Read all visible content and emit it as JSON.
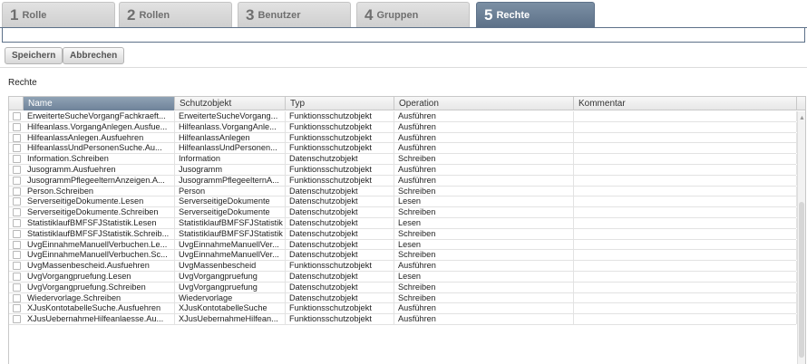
{
  "tabs": [
    {
      "num": "1",
      "label": "Rolle",
      "active": false
    },
    {
      "num": "2",
      "label": "Rollen",
      "active": false
    },
    {
      "num": "3",
      "label": "Benutzer",
      "active": false
    },
    {
      "num": "4",
      "label": "Gruppen",
      "active": false
    },
    {
      "num": "5",
      "label": "Rechte",
      "active": true
    }
  ],
  "toolbar": {
    "save_label": "Speichern",
    "cancel_label": "Abbrechen"
  },
  "section": {
    "title": "Rechte"
  },
  "grid": {
    "columns": [
      "Name",
      "Schutzobjekt",
      "Typ",
      "Operation",
      "Kommentar"
    ],
    "sorted_column": "Name",
    "rows": [
      [
        "ErweiterteSucheVorgangFachkraeft...",
        "ErweiterteSucheVorgang...",
        "Funktionsschutzobjekt",
        "Ausführen",
        ""
      ],
      [
        "Hilfeanlass.VorgangAnlegen.Ausfue...",
        "Hilfeanlass.VorgangAnle...",
        "Funktionsschutzobjekt",
        "Ausführen",
        ""
      ],
      [
        "HilfeanlassAnlegen.Ausfuehren",
        "HilfeanlassAnlegen",
        "Funktionsschutzobjekt",
        "Ausführen",
        ""
      ],
      [
        "HilfeanlassUndPersonenSuche.Au...",
        "HilfeanlassUndPersonen...",
        "Funktionsschutzobjekt",
        "Ausführen",
        ""
      ],
      [
        "Information.Schreiben",
        "Information",
        "Datenschutzobjekt",
        "Schreiben",
        ""
      ],
      [
        "Jusogramm.Ausfuehren",
        "Jusogramm",
        "Funktionsschutzobjekt",
        "Ausführen",
        ""
      ],
      [
        "JusogrammPflegeelternAnzeigen.A...",
        "JusogrammPflegeelternA...",
        "Funktionsschutzobjekt",
        "Ausführen",
        ""
      ],
      [
        "Person.Schreiben",
        "Person",
        "Datenschutzobjekt",
        "Schreiben",
        ""
      ],
      [
        "ServerseitigeDokumente.Lesen",
        "ServerseitigeDokumente",
        "Datenschutzobjekt",
        "Lesen",
        ""
      ],
      [
        "ServerseitigeDokumente.Schreiben",
        "ServerseitigeDokumente",
        "Datenschutzobjekt",
        "Schreiben",
        ""
      ],
      [
        "StatistiklaufBMFSFJStatistik.Lesen",
        "StatistiklaufBMFSFJStatistik",
        "Datenschutzobjekt",
        "Lesen",
        ""
      ],
      [
        "StatistiklaufBMFSFJStatistik.Schreib...",
        "StatistiklaufBMFSFJStatistik",
        "Datenschutzobjekt",
        "Schreiben",
        ""
      ],
      [
        "UvgEinnahmeManuellVerbuchen.Le...",
        "UvgEinnahmeManuellVer...",
        "Datenschutzobjekt",
        "Lesen",
        ""
      ],
      [
        "UvgEinnahmeManuellVerbuchen.Sc...",
        "UvgEinnahmeManuellVer...",
        "Datenschutzobjekt",
        "Schreiben",
        ""
      ],
      [
        "UvgMassenbescheid.Ausfuehren",
        "UvgMassenbescheid",
        "Funktionsschutzobjekt",
        "Ausführen",
        ""
      ],
      [
        "UvgVorgangpruefung.Lesen",
        "UvgVorgangpruefung",
        "Datenschutzobjekt",
        "Lesen",
        ""
      ],
      [
        "UvgVorgangpruefung.Schreiben",
        "UvgVorgangpruefung",
        "Datenschutzobjekt",
        "Schreiben",
        ""
      ],
      [
        "Wiedervorlage.Schreiben",
        "Wiedervorlage",
        "Datenschutzobjekt",
        "Schreiben",
        ""
      ],
      [
        "XJusKontotabelleSuche.Ausfuehren",
        "XJusKontotabelleSuche",
        "Funktionsschutzobjekt",
        "Ausführen",
        ""
      ],
      [
        "XJusUebernahmeHilfeanlaesse.Au...",
        "XJusUebernahmeHilfean...",
        "Funktionsschutzobjekt",
        "Ausführen",
        ""
      ]
    ]
  },
  "colors": {
    "accent": "#5d7189",
    "tab_inactive": "#d9d9d9",
    "header_sorted": "#7b8fa4"
  }
}
